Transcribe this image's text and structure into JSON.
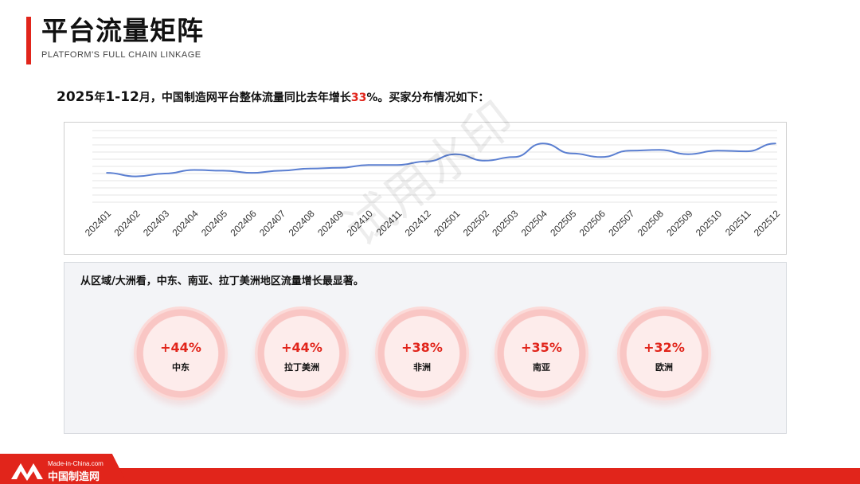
{
  "header": {
    "title": "平台流量矩阵",
    "subtitle": "PLATFORM'S FULL CHAIN LINKAGE"
  },
  "summary": {
    "year": "2025",
    "mid1": "年",
    "range": "1-12",
    "mid2": "月，中国制造网平台整体流量同比去年增长",
    "growth": "33",
    "suffix": "%。买家分布情况如下："
  },
  "chart_data": {
    "type": "line",
    "x": [
      "202401",
      "202402",
      "202403",
      "202404",
      "202405",
      "202406",
      "202407",
      "202408",
      "202409",
      "202410",
      "202411",
      "202412",
      "202501",
      "202502",
      "202503",
      "202504",
      "202505",
      "202506",
      "202507",
      "202508",
      "202509",
      "202510",
      "202511",
      "202512"
    ],
    "series": [
      {
        "values": [
          41,
          36,
          40,
          45,
          44,
          41,
          44,
          47,
          48,
          52,
          52,
          57,
          67,
          58,
          63,
          82,
          68,
          63,
          72,
          73,
          67,
          72,
          71,
          82
        ],
        "color": "#5b7fd1"
      }
    ],
    "ylim": [
      0,
      100
    ],
    "grid": true
  },
  "regions": {
    "intro": "从区域/大洲看，中东、南亚、拉丁美洲地区流量增长最显著。",
    "items": [
      {
        "pct": "+44%",
        "name": "中东"
      },
      {
        "pct": "+44%",
        "name": "拉丁美洲"
      },
      {
        "pct": "+38%",
        "name": "非洲"
      },
      {
        "pct": "+35%",
        "name": "南亚"
      },
      {
        "pct": "+32%",
        "name": "欧洲"
      }
    ]
  },
  "watermark": "试用水印",
  "footer": {
    "logo_en": "Made-in-China.com",
    "logo_cn": "中国制造网"
  },
  "colors": {
    "accent": "#e1251b",
    "line": "#5b7fd1"
  }
}
